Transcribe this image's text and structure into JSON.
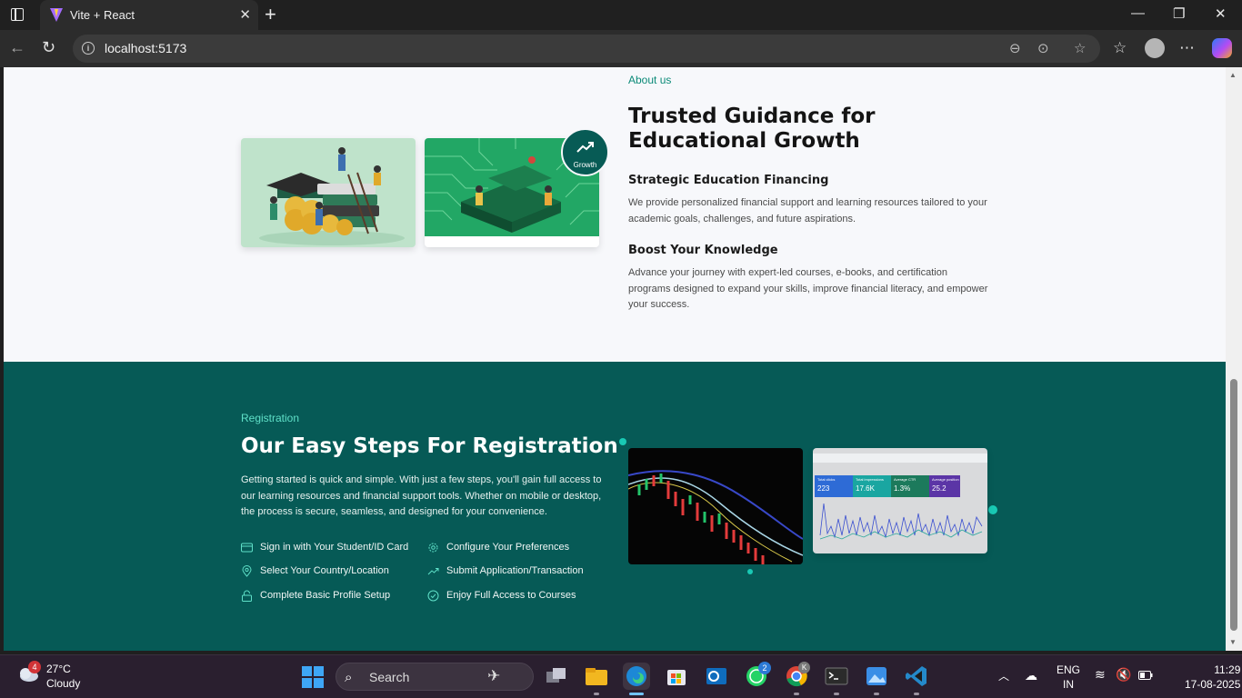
{
  "browser": {
    "tab_title": "Vite + React",
    "url": "localhost:5173"
  },
  "about": {
    "eyebrow": "About us",
    "heading": "Trusted Guidance for Educational Growth",
    "badge_label": "Growth",
    "feature1_title": "Strategic Education Financing",
    "feature1_text": "We provide personalized financial support and learning resources tailored to your academic goals, challenges, and future aspirations.",
    "feature2_title": "Boost Your Knowledge",
    "feature2_text": "Advance your journey with expert-led courses, e-books, and certification programs designed to expand your skills, improve financial literacy, and empower your success."
  },
  "registration": {
    "eyebrow": "Registration",
    "heading": "Our Easy Steps For Registration",
    "text": "Getting started is quick and simple. With just a few steps, you'll gain full access to our learning resources and financial support tools. Whether on mobile or desktop, the process is secure, seamless, and designed for your convenience.",
    "steps": [
      {
        "label": "Sign in with Your Student/ID Card",
        "icon": "id-card-icon"
      },
      {
        "label": "Configure Your Preferences",
        "icon": "gear-icon"
      },
      {
        "label": "Select Your Country/Location",
        "icon": "location-pin-icon"
      },
      {
        "label": "Submit Application/Transaction",
        "icon": "trending-up-icon"
      },
      {
        "label": "Complete Basic Profile Setup",
        "icon": "lock-icon"
      },
      {
        "label": "Enjoy Full Access to Courses",
        "icon": "check-circle-icon"
      }
    ],
    "stats": [
      {
        "label": "Total clicks",
        "value": "223"
      },
      {
        "label": "Total impressions",
        "value": "17.6K"
      },
      {
        "label": "Average CTR",
        "value": "1.3%"
      },
      {
        "label": "Average position",
        "value": "25.2"
      }
    ]
  },
  "taskbar": {
    "weather_badge": "4",
    "temperature": "27°C",
    "condition": "Cloudy",
    "search_placeholder": "Search",
    "whatsapp_badge": "2",
    "chrome_badge": "K",
    "lang_top": "ENG",
    "lang_bottom": "IN",
    "time": "11:29",
    "date": "17-08-2025"
  },
  "colors": {
    "accent": "#065a56",
    "eyebrow": "#0b8a77",
    "teal_dot": "#19c9b4"
  }
}
